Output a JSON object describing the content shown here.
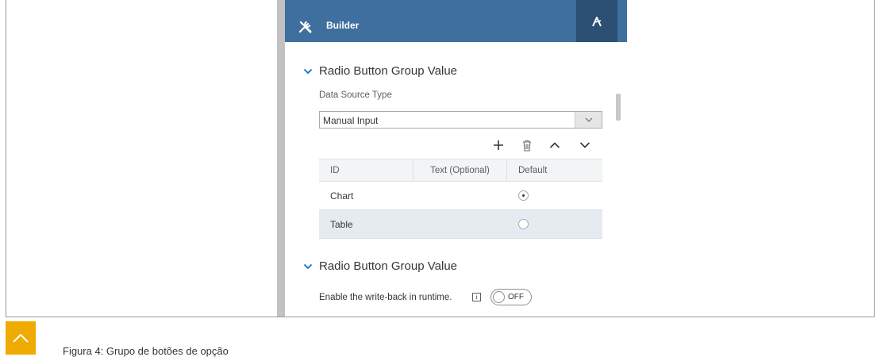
{
  "header": {
    "title": "Builder",
    "left_icon": "tools-icon",
    "right_icon": "styling-brush-icon"
  },
  "section1": {
    "title": "Radio Button Group Value",
    "data_source_label": "Data Source Type",
    "data_source_value": "Manual Input",
    "toolbar": [
      "add-icon",
      "delete-icon",
      "move-up-icon",
      "move-down-icon"
    ],
    "table": {
      "headers": {
        "id": "ID",
        "text": "Text (Optional)",
        "default": "Default"
      },
      "rows": [
        {
          "id": "Chart",
          "text": "",
          "default_selected": true
        },
        {
          "id": "Table",
          "text": "",
          "default_selected": false
        }
      ]
    }
  },
  "section2": {
    "title": "Radio Button Group Value",
    "write_back_label": "Enable the write-back in runtime.",
    "info_icon_text": "i",
    "toggle_text": "OFF",
    "toggle_on": false
  },
  "footer": {
    "caption": "Figura 4: Grupo de botões de opção",
    "scroll_top_icon": "chevron-up-icon",
    "accent_color": "#f0ab00"
  },
  "colors": {
    "header": "#3f6f9e",
    "header_button": "#2c4f74",
    "selected_row": "#e5ebf1"
  }
}
